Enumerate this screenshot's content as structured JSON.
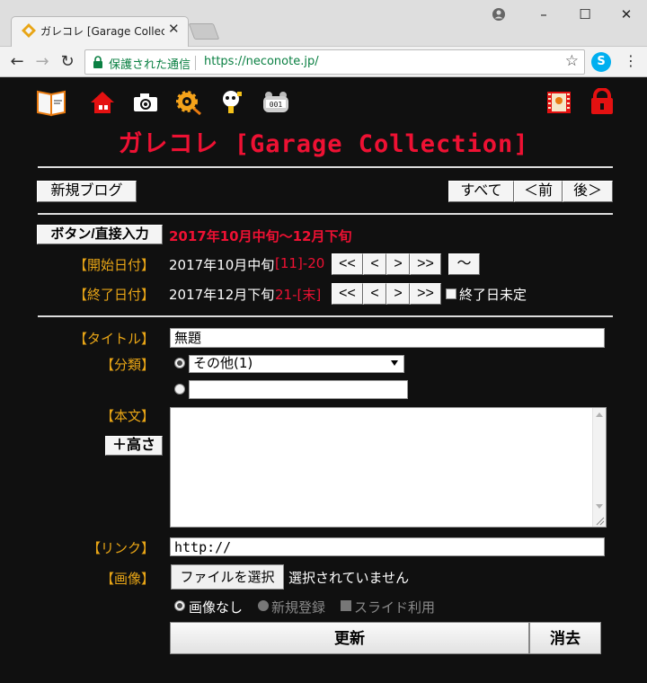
{
  "window": {
    "controls": {
      "minimize": "–",
      "maximize": "☐",
      "close": "✕"
    }
  },
  "tab": {
    "title": "ガレコレ [Garage Collection]",
    "close": "✕"
  },
  "toolbar": {
    "secure_text": "保護された通信",
    "url": "https://neconote.jp/",
    "back": "←",
    "forward": "→",
    "reload": "↻",
    "star": "☆",
    "menu": "⋮",
    "skype": "S"
  },
  "site": {
    "title": "ガレコレ [Garage Collection]"
  },
  "nav": {
    "new_blog": "新規ブログ",
    "all": "すべて",
    "prev": "＜前",
    "next": "後＞"
  },
  "range": {
    "mode_button": "ボタン/直接入力",
    "title": "2017年10月中旬〜12月下旬",
    "start": {
      "label": "【開始日付】",
      "value": "2017年10月中旬",
      "range": "[11]-20",
      "buttons": [
        "<<",
        "<",
        ">",
        ">>"
      ],
      "tilde_button": "〜"
    },
    "end": {
      "label": "【終了日付】",
      "value": "2017年12月下旬",
      "range": "21-[末]",
      "buttons": [
        "<<",
        "<",
        ">",
        ">>"
      ],
      "undecided_label": "終了日未定"
    }
  },
  "form": {
    "title_label": "【タイトル】",
    "title_value": "無題",
    "category_label": "【分類】",
    "category_selected": "その他(1)",
    "category_new_value": "",
    "body_label": "【本文】",
    "height_button": "＋高さ",
    "link_label": "【リンク】",
    "link_value": "http://",
    "image_label": "【画像】",
    "file_button": "ファイルを選択",
    "file_status": "選択されていません",
    "image_none": "画像なし",
    "image_new": "新規登録",
    "slide_use": "スライド利用",
    "update_button": "更新",
    "delete_button": "消去"
  },
  "colors": {
    "accent_red": "#ee1133",
    "label_orange": "#e8a516",
    "background": "#101010"
  },
  "icons": [
    "blog-book-icon",
    "house-icon",
    "camera-icon",
    "gear-icon",
    "mascot-icon",
    "counter-icon",
    "film-icon",
    "lock-icon"
  ]
}
